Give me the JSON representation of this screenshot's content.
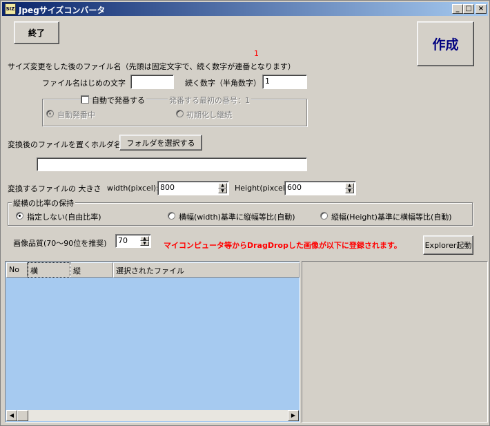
{
  "window": {
    "title": "Jpegサイズコンバータ",
    "icon": "app-icon",
    "icon_text": "SIZ"
  },
  "titlebar_buttons": {
    "minimize": "_",
    "maximize": "□",
    "close": "×"
  },
  "buttons": {
    "exit": "終了",
    "create": "作成",
    "select_folder": "フォルダを選択する",
    "explorer": "Explorer起動"
  },
  "counter_marker": "1",
  "filename_section": {
    "heading": "サイズ変更をした後のファイル名（先頭は固定文字で、続く数字が連番となります）",
    "prefix_label": "ファイル名はじめの文字",
    "prefix_value": "",
    "seq_label": "続く数字（半角数字）",
    "seq_value": "1"
  },
  "auto_numbering": {
    "checkbox_label": "自動で発番する",
    "checked": false,
    "first_number_label": "発番する最初の番号：1",
    "option_auto": "自動発番中",
    "option_reset": "初期化し継続",
    "selected": "auto"
  },
  "folder": {
    "label": "変換後のファイルを置くホルダ名:",
    "path": ""
  },
  "size": {
    "label": "変換するファイルの 大きさ",
    "width_label": "width(pixcel):",
    "width_value": "800",
    "height_label": "Height(pixcel):",
    "height_value": "600"
  },
  "ratio": {
    "title": "縦横の比率の保持",
    "options": [
      "指定しない(自由比率)",
      "横幅(width)基準に縦幅等比(自動)",
      "縦幅(Height)基準に横幅等比(自動)"
    ],
    "selected_index": 0
  },
  "quality": {
    "label": "画像品質(70～90位を推奨)",
    "value": "70"
  },
  "notice": {
    "text": "マイコンピュータ等からDragDropした画像が以下に登録されます。",
    "color": "#ff0000"
  },
  "file_list": {
    "columns": [
      "No",
      "横",
      "縦",
      "選択されたファイル"
    ],
    "rows": []
  },
  "colors": {
    "list_bg": "#a6caf0",
    "face": "#d4d0c8",
    "title_from": "#0a246a",
    "title_to": "#a6caf0",
    "notice": "#ff0000",
    "create_text": "#000080"
  }
}
